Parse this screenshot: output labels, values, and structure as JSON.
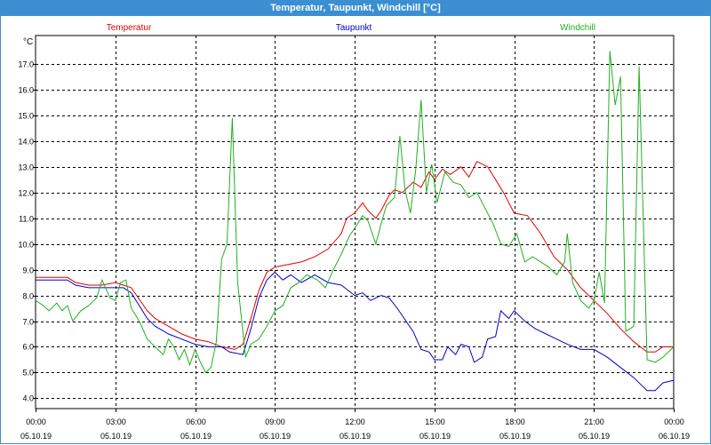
{
  "window": {
    "title": "Temperatur, Taupunkt, Windchill [°C]"
  },
  "colors": {
    "temperature": "#e00000",
    "dewpoint": "#0000c8",
    "windchill": "#20b020",
    "titlebar": "#3a8ed1"
  },
  "chart_data": {
    "type": "line",
    "title": "Temperatur, Taupunkt, Windchill [°C]",
    "ylabel": "°C",
    "ylim": [
      3.6,
      18.1
    ],
    "yticks": [
      4.0,
      5.0,
      6.0,
      7.0,
      8.0,
      9.0,
      10.0,
      11.0,
      12.0,
      13.0,
      14.0,
      15.0,
      16.0,
      17.0
    ],
    "xlim": [
      0,
      24
    ],
    "x_unit": "hours since 05.10.19 00:00",
    "xticks": [
      {
        "time": "00:00",
        "date": "05.10.19"
      },
      {
        "time": "03:00",
        "date": "05.10.19"
      },
      {
        "time": "06:00",
        "date": "05.10.19"
      },
      {
        "time": "09:00",
        "date": "05.10.19"
      },
      {
        "time": "12:00",
        "date": "05.10.19"
      },
      {
        "time": "15:00",
        "date": "05.10.19"
      },
      {
        "time": "18:00",
        "date": "05.10.19"
      },
      {
        "time": "21:00",
        "date": "05.10.19"
      },
      {
        "time": "00:00",
        "date": "06.10.19"
      }
    ],
    "grid": true,
    "legend_position": "top",
    "series": [
      {
        "name": "Temperatur",
        "color": "#e00000",
        "points": [
          [
            0,
            8.7
          ],
          [
            0.6,
            8.7
          ],
          [
            1.2,
            8.7
          ],
          [
            1.5,
            8.5
          ],
          [
            2.0,
            8.4
          ],
          [
            2.5,
            8.4
          ],
          [
            3.0,
            8.5
          ],
          [
            3.3,
            8.4
          ],
          [
            3.6,
            8.3
          ],
          [
            3.8,
            8.0
          ],
          [
            4.2,
            7.4
          ],
          [
            4.5,
            7.1
          ],
          [
            5.0,
            6.8
          ],
          [
            5.5,
            6.5
          ],
          [
            6.0,
            6.3
          ],
          [
            6.5,
            6.2
          ],
          [
            7.0,
            6.0
          ],
          [
            7.5,
            5.9
          ],
          [
            7.8,
            6.1
          ],
          [
            8.1,
            7.1
          ],
          [
            8.4,
            8.2
          ],
          [
            8.7,
            8.9
          ],
          [
            9.0,
            9.1
          ],
          [
            9.5,
            9.2
          ],
          [
            10.0,
            9.3
          ],
          [
            10.5,
            9.5
          ],
          [
            11.0,
            9.8
          ],
          [
            11.5,
            10.4
          ],
          [
            11.7,
            11.0
          ],
          [
            12.0,
            11.2
          ],
          [
            12.3,
            11.6
          ],
          [
            12.5,
            11.3
          ],
          [
            12.8,
            11.0
          ],
          [
            13.0,
            11.3
          ],
          [
            13.3,
            11.9
          ],
          [
            13.5,
            12.1
          ],
          [
            13.8,
            12.0
          ],
          [
            14.2,
            12.4
          ],
          [
            14.5,
            12.2
          ],
          [
            14.8,
            12.8
          ],
          [
            15.0,
            12.5
          ],
          [
            15.3,
            12.9
          ],
          [
            15.6,
            12.7
          ],
          [
            16.0,
            13.0
          ],
          [
            16.3,
            12.6
          ],
          [
            16.6,
            13.2
          ],
          [
            17.0,
            13.0
          ],
          [
            17.3,
            12.5
          ],
          [
            17.6,
            12.0
          ],
          [
            18.0,
            11.2
          ],
          [
            18.5,
            11.1
          ],
          [
            19.0,
            10.4
          ],
          [
            19.5,
            9.5
          ],
          [
            20.0,
            9.0
          ],
          [
            20.5,
            8.3
          ],
          [
            21.0,
            7.8
          ],
          [
            21.5,
            7.3
          ],
          [
            22.0,
            6.7
          ],
          [
            22.5,
            6.2
          ],
          [
            23.0,
            5.8
          ],
          [
            23.3,
            5.8
          ],
          [
            23.6,
            6.0
          ],
          [
            24.0,
            6.0
          ]
        ]
      },
      {
        "name": "Taupunkt",
        "color": "#0000c8",
        "points": [
          [
            0,
            8.6
          ],
          [
            0.6,
            8.6
          ],
          [
            1.2,
            8.6
          ],
          [
            1.5,
            8.4
          ],
          [
            2.0,
            8.3
          ],
          [
            2.5,
            8.3
          ],
          [
            3.0,
            8.3
          ],
          [
            3.3,
            8.3
          ],
          [
            3.6,
            8.1
          ],
          [
            3.9,
            7.6
          ],
          [
            4.2,
            7.1
          ],
          [
            4.5,
            6.8
          ],
          [
            5.0,
            6.5
          ],
          [
            5.5,
            6.3
          ],
          [
            6.0,
            6.1
          ],
          [
            6.5,
            6.0
          ],
          [
            7.0,
            6.0
          ],
          [
            7.3,
            5.8
          ],
          [
            7.8,
            5.7
          ],
          [
            8.1,
            6.7
          ],
          [
            8.4,
            7.9
          ],
          [
            8.7,
            8.6
          ],
          [
            9.0,
            8.9
          ],
          [
            9.3,
            8.6
          ],
          [
            9.6,
            8.8
          ],
          [
            10.0,
            8.5
          ],
          [
            10.5,
            8.8
          ],
          [
            11.0,
            8.5
          ],
          [
            11.5,
            8.4
          ],
          [
            12.0,
            8.0
          ],
          [
            12.3,
            8.1
          ],
          [
            12.6,
            7.8
          ],
          [
            13.0,
            8.0
          ],
          [
            13.3,
            7.9
          ],
          [
            13.6,
            7.5
          ],
          [
            14.0,
            6.9
          ],
          [
            14.2,
            6.6
          ],
          [
            14.5,
            5.9
          ],
          [
            14.8,
            5.8
          ],
          [
            15.0,
            5.5
          ],
          [
            15.3,
            5.5
          ],
          [
            15.5,
            6.0
          ],
          [
            15.8,
            5.7
          ],
          [
            16.0,
            6.1
          ],
          [
            16.3,
            6.0
          ],
          [
            16.5,
            5.4
          ],
          [
            16.8,
            5.6
          ],
          [
            17.0,
            6.3
          ],
          [
            17.3,
            6.4
          ],
          [
            17.5,
            7.4
          ],
          [
            17.8,
            7.1
          ],
          [
            18.0,
            7.4
          ],
          [
            18.4,
            7.0
          ],
          [
            18.8,
            6.7
          ],
          [
            19.2,
            6.5
          ],
          [
            19.6,
            6.3
          ],
          [
            20.0,
            6.1
          ],
          [
            20.5,
            5.9
          ],
          [
            21.0,
            5.9
          ],
          [
            21.5,
            5.6
          ],
          [
            22.0,
            5.2
          ],
          [
            22.5,
            4.8
          ],
          [
            23.0,
            4.3
          ],
          [
            23.3,
            4.3
          ],
          [
            23.6,
            4.6
          ],
          [
            24.0,
            4.7
          ]
        ]
      },
      {
        "name": "Windchill",
        "color": "#20b020",
        "points": [
          [
            0,
            7.8
          ],
          [
            0.3,
            7.6
          ],
          [
            0.5,
            7.4
          ],
          [
            0.8,
            7.7
          ],
          [
            1.0,
            7.4
          ],
          [
            1.2,
            7.6
          ],
          [
            1.4,
            7.0
          ],
          [
            1.7,
            7.4
          ],
          [
            2.0,
            7.6
          ],
          [
            2.3,
            7.9
          ],
          [
            2.5,
            8.6
          ],
          [
            2.8,
            7.9
          ],
          [
            3.0,
            7.8
          ],
          [
            3.2,
            8.5
          ],
          [
            3.4,
            8.6
          ],
          [
            3.6,
            7.5
          ],
          [
            3.9,
            7.0
          ],
          [
            4.2,
            6.3
          ],
          [
            4.5,
            6.0
          ],
          [
            4.8,
            5.7
          ],
          [
            5.0,
            6.3
          ],
          [
            5.2,
            6.0
          ],
          [
            5.4,
            5.5
          ],
          [
            5.6,
            5.9
          ],
          [
            5.8,
            5.3
          ],
          [
            6.0,
            5.9
          ],
          [
            6.2,
            5.4
          ],
          [
            6.4,
            5.0
          ],
          [
            6.6,
            5.2
          ],
          [
            6.8,
            6.2
          ],
          [
            7.0,
            9.4
          ],
          [
            7.2,
            10.0
          ],
          [
            7.4,
            14.9
          ],
          [
            7.6,
            8.5
          ],
          [
            7.9,
            5.6
          ],
          [
            8.1,
            6.1
          ],
          [
            8.4,
            6.3
          ],
          [
            8.7,
            6.8
          ],
          [
            9.0,
            7.4
          ],
          [
            9.3,
            7.6
          ],
          [
            9.6,
            8.3
          ],
          [
            9.9,
            8.5
          ],
          [
            10.2,
            8.8
          ],
          [
            10.6,
            8.6
          ],
          [
            10.9,
            8.3
          ],
          [
            11.2,
            9.0
          ],
          [
            11.5,
            9.6
          ],
          [
            11.8,
            10.3
          ],
          [
            12.0,
            10.6
          ],
          [
            12.3,
            11.1
          ],
          [
            12.5,
            10.9
          ],
          [
            12.8,
            10.0
          ],
          [
            13.0,
            10.8
          ],
          [
            13.2,
            11.5
          ],
          [
            13.5,
            11.8
          ],
          [
            13.7,
            14.2
          ],
          [
            13.9,
            12.1
          ],
          [
            14.1,
            11.2
          ],
          [
            14.3,
            12.9
          ],
          [
            14.5,
            15.6
          ],
          [
            14.7,
            12.0
          ],
          [
            14.9,
            13.1
          ],
          [
            15.1,
            11.6
          ],
          [
            15.4,
            12.8
          ],
          [
            15.7,
            12.4
          ],
          [
            16.0,
            12.3
          ],
          [
            16.3,
            11.8
          ],
          [
            16.6,
            12.0
          ],
          [
            16.9,
            11.4
          ],
          [
            17.2,
            10.8
          ],
          [
            17.5,
            10.0
          ],
          [
            17.8,
            9.9
          ],
          [
            18.1,
            10.4
          ],
          [
            18.4,
            9.3
          ],
          [
            18.7,
            9.5
          ],
          [
            19.0,
            9.3
          ],
          [
            19.3,
            9.1
          ],
          [
            19.6,
            8.8
          ],
          [
            19.9,
            9.3
          ],
          [
            20.0,
            10.4
          ],
          [
            20.2,
            8.5
          ],
          [
            20.5,
            7.8
          ],
          [
            20.8,
            7.5
          ],
          [
            21.0,
            7.8
          ],
          [
            21.2,
            8.9
          ],
          [
            21.4,
            7.7
          ],
          [
            21.6,
            17.5
          ],
          [
            21.8,
            15.4
          ],
          [
            22.0,
            16.5
          ],
          [
            22.2,
            6.6
          ],
          [
            22.5,
            6.8
          ],
          [
            22.7,
            16.9
          ],
          [
            23.0,
            5.5
          ],
          [
            23.3,
            5.4
          ],
          [
            23.6,
            5.6
          ],
          [
            24.0,
            6.0
          ]
        ]
      }
    ]
  }
}
